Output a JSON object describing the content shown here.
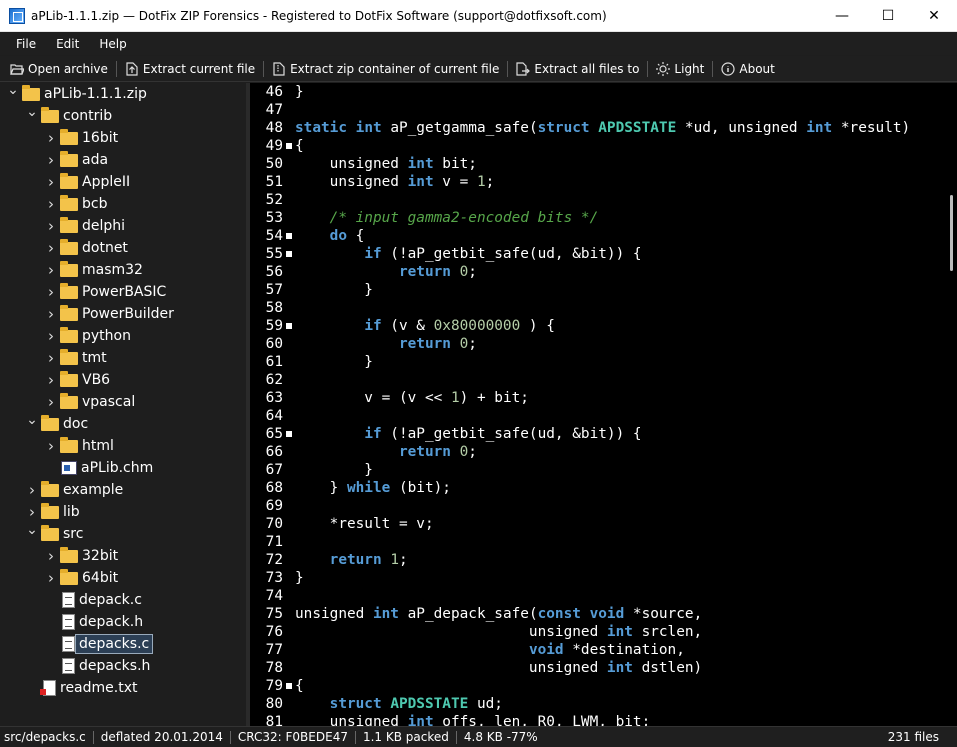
{
  "window": {
    "title": "aPLib-1.1.1.zip — DotFix ZIP Forensics - Registered to DotFix Software (support@dotfixsoft.com)",
    "minimize": "—",
    "maximize": "☐",
    "close": "✕"
  },
  "menu": [
    "File",
    "Edit",
    "Help"
  ],
  "toolbar": {
    "open_archive": "Open archive",
    "extract_current": "Extract current file",
    "extract_container": "Extract zip container of current file",
    "extract_all": "Extract all files to",
    "light": "Light",
    "about": "About"
  },
  "tree": [
    {
      "label": "aPLib-1.1.1.zip",
      "type": "folder",
      "expanded": true,
      "depth": 0
    },
    {
      "label": "contrib",
      "type": "folder",
      "expanded": true,
      "depth": 1
    },
    {
      "label": "16bit",
      "type": "folder",
      "expanded": false,
      "depth": 2
    },
    {
      "label": "ada",
      "type": "folder",
      "expanded": false,
      "depth": 2
    },
    {
      "label": "AppleII",
      "type": "folder",
      "expanded": false,
      "depth": 2
    },
    {
      "label": "bcb",
      "type": "folder",
      "expanded": false,
      "depth": 2
    },
    {
      "label": "delphi",
      "type": "folder",
      "expanded": false,
      "depth": 2
    },
    {
      "label": "dotnet",
      "type": "folder",
      "expanded": false,
      "depth": 2
    },
    {
      "label": "masm32",
      "type": "folder",
      "expanded": false,
      "depth": 2
    },
    {
      "label": "PowerBASIC",
      "type": "folder",
      "expanded": false,
      "depth": 2
    },
    {
      "label": "PowerBuilder",
      "type": "folder",
      "expanded": false,
      "depth": 2
    },
    {
      "label": "python",
      "type": "folder",
      "expanded": false,
      "depth": 2
    },
    {
      "label": "tmt",
      "type": "folder",
      "expanded": false,
      "depth": 2
    },
    {
      "label": "VB6",
      "type": "folder",
      "expanded": false,
      "depth": 2
    },
    {
      "label": "vpascal",
      "type": "folder",
      "expanded": false,
      "depth": 2
    },
    {
      "label": "doc",
      "type": "folder",
      "expanded": true,
      "depth": 1
    },
    {
      "label": "html",
      "type": "folder",
      "expanded": false,
      "depth": 2
    },
    {
      "label": "aPLib.chm",
      "type": "chm",
      "depth": 2
    },
    {
      "label": "example",
      "type": "folder",
      "expanded": false,
      "depth": 1
    },
    {
      "label": "lib",
      "type": "folder",
      "expanded": false,
      "depth": 1
    },
    {
      "label": "src",
      "type": "folder",
      "expanded": true,
      "depth": 1
    },
    {
      "label": "32bit",
      "type": "folder",
      "expanded": false,
      "depth": 2
    },
    {
      "label": "64bit",
      "type": "folder",
      "expanded": false,
      "depth": 2
    },
    {
      "label": "depack.c",
      "type": "file",
      "depth": 2
    },
    {
      "label": "depack.h",
      "type": "file",
      "depth": 2
    },
    {
      "label": "depacks.c",
      "type": "file",
      "depth": 2,
      "selected": true
    },
    {
      "label": "depacks.h",
      "type": "file",
      "depth": 2
    },
    {
      "label": "readme.txt",
      "type": "txt",
      "depth": 1
    }
  ],
  "code": [
    {
      "n": "46",
      "fold": false,
      "t": [
        [
          "",
          "}"
        ]
      ]
    },
    {
      "n": "47",
      "fold": false,
      "t": []
    },
    {
      "n": "48",
      "fold": false,
      "t": [
        [
          "kw",
          "static"
        ],
        [
          "",
          " "
        ],
        [
          "kw",
          "int"
        ],
        [
          "",
          " aP_getgamma_safe("
        ],
        [
          "kw",
          "struct"
        ],
        [
          "",
          " "
        ],
        [
          "ty",
          "APDSSTATE"
        ],
        [
          "",
          " *ud, unsigned "
        ],
        [
          "kw",
          "int"
        ],
        [
          "",
          " *result)"
        ]
      ]
    },
    {
      "n": "49",
      "fold": true,
      "t": [
        [
          "",
          "{"
        ]
      ]
    },
    {
      "n": "50",
      "fold": false,
      "t": [
        [
          "",
          "    unsigned "
        ],
        [
          "kw",
          "int"
        ],
        [
          "",
          " bit;"
        ]
      ]
    },
    {
      "n": "51",
      "fold": false,
      "t": [
        [
          "",
          "    unsigned "
        ],
        [
          "kw",
          "int"
        ],
        [
          "",
          " v = "
        ],
        [
          "num",
          "1"
        ],
        [
          "",
          ";"
        ]
      ]
    },
    {
      "n": "52",
      "fold": false,
      "t": []
    },
    {
      "n": "53",
      "fold": false,
      "t": [
        [
          "",
          "    "
        ],
        [
          "cm",
          "/* input gamma2-encoded bits */"
        ]
      ]
    },
    {
      "n": "54",
      "fold": true,
      "t": [
        [
          "",
          "    "
        ],
        [
          "kw",
          "do"
        ],
        [
          "",
          " {"
        ]
      ]
    },
    {
      "n": "55",
      "fold": true,
      "t": [
        [
          "",
          "        "
        ],
        [
          "kw",
          "if"
        ],
        [
          "",
          " (!aP_getbit_safe(ud, &bit)) {"
        ]
      ]
    },
    {
      "n": "56",
      "fold": false,
      "t": [
        [
          "",
          "            "
        ],
        [
          "kw",
          "return"
        ],
        [
          "",
          " "
        ],
        [
          "num",
          "0"
        ],
        [
          "",
          ";"
        ]
      ]
    },
    {
      "n": "57",
      "fold": false,
      "t": [
        [
          "",
          "        }"
        ]
      ]
    },
    {
      "n": "58",
      "fold": false,
      "t": []
    },
    {
      "n": "59",
      "fold": true,
      "t": [
        [
          "",
          "        "
        ],
        [
          "kw",
          "if"
        ],
        [
          "",
          " (v & "
        ],
        [
          "num",
          "0x80000000"
        ],
        [
          "",
          " ) {"
        ]
      ]
    },
    {
      "n": "60",
      "fold": false,
      "t": [
        [
          "",
          "            "
        ],
        [
          "kw",
          "return"
        ],
        [
          "",
          " "
        ],
        [
          "num",
          "0"
        ],
        [
          "",
          ";"
        ]
      ]
    },
    {
      "n": "61",
      "fold": false,
      "t": [
        [
          "",
          "        }"
        ]
      ]
    },
    {
      "n": "62",
      "fold": false,
      "t": []
    },
    {
      "n": "63",
      "fold": false,
      "t": [
        [
          "",
          "        v = (v << "
        ],
        [
          "num",
          "1"
        ],
        [
          "",
          ") + bit;"
        ]
      ]
    },
    {
      "n": "64",
      "fold": false,
      "t": []
    },
    {
      "n": "65",
      "fold": true,
      "t": [
        [
          "",
          "        "
        ],
        [
          "kw",
          "if"
        ],
        [
          "",
          " (!aP_getbit_safe(ud, &bit)) {"
        ]
      ]
    },
    {
      "n": "66",
      "fold": false,
      "t": [
        [
          "",
          "            "
        ],
        [
          "kw",
          "return"
        ],
        [
          "",
          " "
        ],
        [
          "num",
          "0"
        ],
        [
          "",
          ";"
        ]
      ]
    },
    {
      "n": "67",
      "fold": false,
      "t": [
        [
          "",
          "        }"
        ]
      ]
    },
    {
      "n": "68",
      "fold": false,
      "t": [
        [
          "",
          "    } "
        ],
        [
          "kw",
          "while"
        ],
        [
          "",
          " (bit);"
        ]
      ]
    },
    {
      "n": "69",
      "fold": false,
      "t": []
    },
    {
      "n": "70",
      "fold": false,
      "t": [
        [
          "",
          "    *result = v;"
        ]
      ]
    },
    {
      "n": "71",
      "fold": false,
      "t": []
    },
    {
      "n": "72",
      "fold": false,
      "t": [
        [
          "",
          "    "
        ],
        [
          "kw",
          "return"
        ],
        [
          "",
          " "
        ],
        [
          "num",
          "1"
        ],
        [
          "",
          ";"
        ]
      ]
    },
    {
      "n": "73",
      "fold": false,
      "t": [
        [
          "",
          "}"
        ]
      ]
    },
    {
      "n": "74",
      "fold": false,
      "t": []
    },
    {
      "n": "75",
      "fold": false,
      "t": [
        [
          "",
          "unsigned "
        ],
        [
          "kw",
          "int"
        ],
        [
          "",
          " aP_depack_safe("
        ],
        [
          "kw",
          "const"
        ],
        [
          "",
          " "
        ],
        [
          "kw",
          "void"
        ],
        [
          "",
          " *source,"
        ]
      ]
    },
    {
      "n": "76",
      "fold": false,
      "t": [
        [
          "",
          "                           unsigned "
        ],
        [
          "kw",
          "int"
        ],
        [
          "",
          " srclen,"
        ]
      ]
    },
    {
      "n": "77",
      "fold": false,
      "t": [
        [
          "",
          "                           "
        ],
        [
          "kw",
          "void"
        ],
        [
          "",
          " *destination,"
        ]
      ]
    },
    {
      "n": "78",
      "fold": false,
      "t": [
        [
          "",
          "                           unsigned "
        ],
        [
          "kw",
          "int"
        ],
        [
          "",
          " dstlen)"
        ]
      ]
    },
    {
      "n": "79",
      "fold": true,
      "t": [
        [
          "",
          "{"
        ]
      ]
    },
    {
      "n": "80",
      "fold": false,
      "t": [
        [
          "",
          "    "
        ],
        [
          "kw",
          "struct"
        ],
        [
          "",
          " "
        ],
        [
          "ty",
          "APDSSTATE"
        ],
        [
          "",
          " ud;"
        ]
      ]
    },
    {
      "n": "81",
      "fold": false,
      "t": [
        [
          "",
          "    unsigned "
        ],
        [
          "kw",
          "int"
        ],
        [
          "",
          " offs, len, R0, LWM, bit;"
        ]
      ]
    }
  ],
  "status": {
    "path": "src/depacks.c",
    "method": "deflated  20.01.2014",
    "crc": "CRC32: F0BEDE47",
    "packed": "1.1 KB packed",
    "unpacked": "4.8 KB  -77%",
    "file_count": "231 files"
  }
}
